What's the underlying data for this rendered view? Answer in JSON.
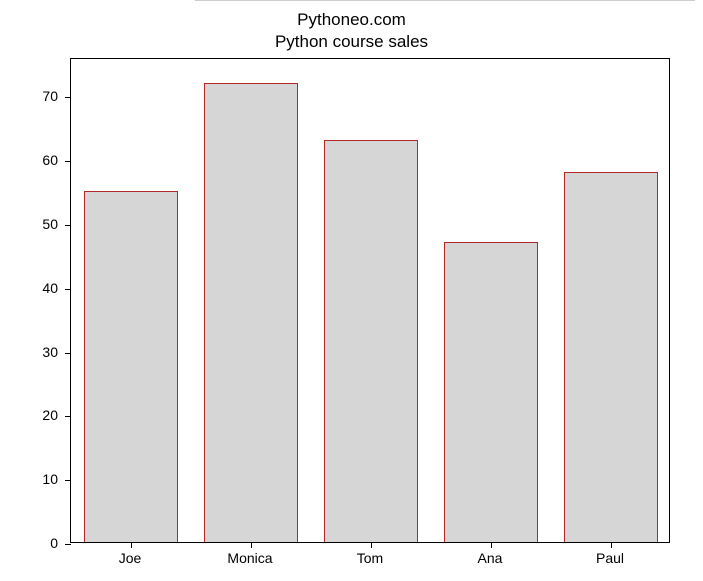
{
  "chart_data": {
    "type": "bar",
    "categories": [
      "Joe",
      "Monica",
      "Tom",
      "Ana",
      "Paul"
    ],
    "values": [
      55,
      72,
      63,
      47,
      58
    ],
    "title": "Python course sales",
    "suptitle": "Pythoneo.com",
    "xlabel": "",
    "ylabel": "",
    "ylim": [
      0,
      76
    ],
    "yticks": [
      0,
      10,
      20,
      30,
      40,
      50,
      60,
      70
    ],
    "bar_fill": "#d6d6d6",
    "bar_edge": "#b52828"
  }
}
